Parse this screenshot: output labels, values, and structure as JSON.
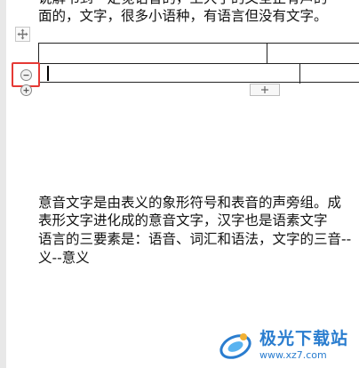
{
  "document": {
    "top_text_line1": "说解书到一定觉语音的，上大了的文全正有声的",
    "top_text_line2": "面的，文字，很多小语种，有语言但没有文字。",
    "paragraph": [
      "意音文字是由表义的象形符号和表音的声旁组。成",
      "表形文字进化成的意音文字，汉字也是语素文字",
      "语言的三要素是：语音、词汇和语法，文字的三音--",
      "义--意义"
    ]
  },
  "table": {
    "rows": 2,
    "cursor_row": 2
  },
  "controls": {
    "move_handle_icon": "move-arrows-icon",
    "delete_row_icon": "circle-minus-icon",
    "add_row_icon": "circle-plus-icon",
    "add_column_icon": "plus-icon"
  },
  "highlight_color": "#e53935",
  "watermark": {
    "name": "极光下载站",
    "url": "www.xz7.com"
  }
}
